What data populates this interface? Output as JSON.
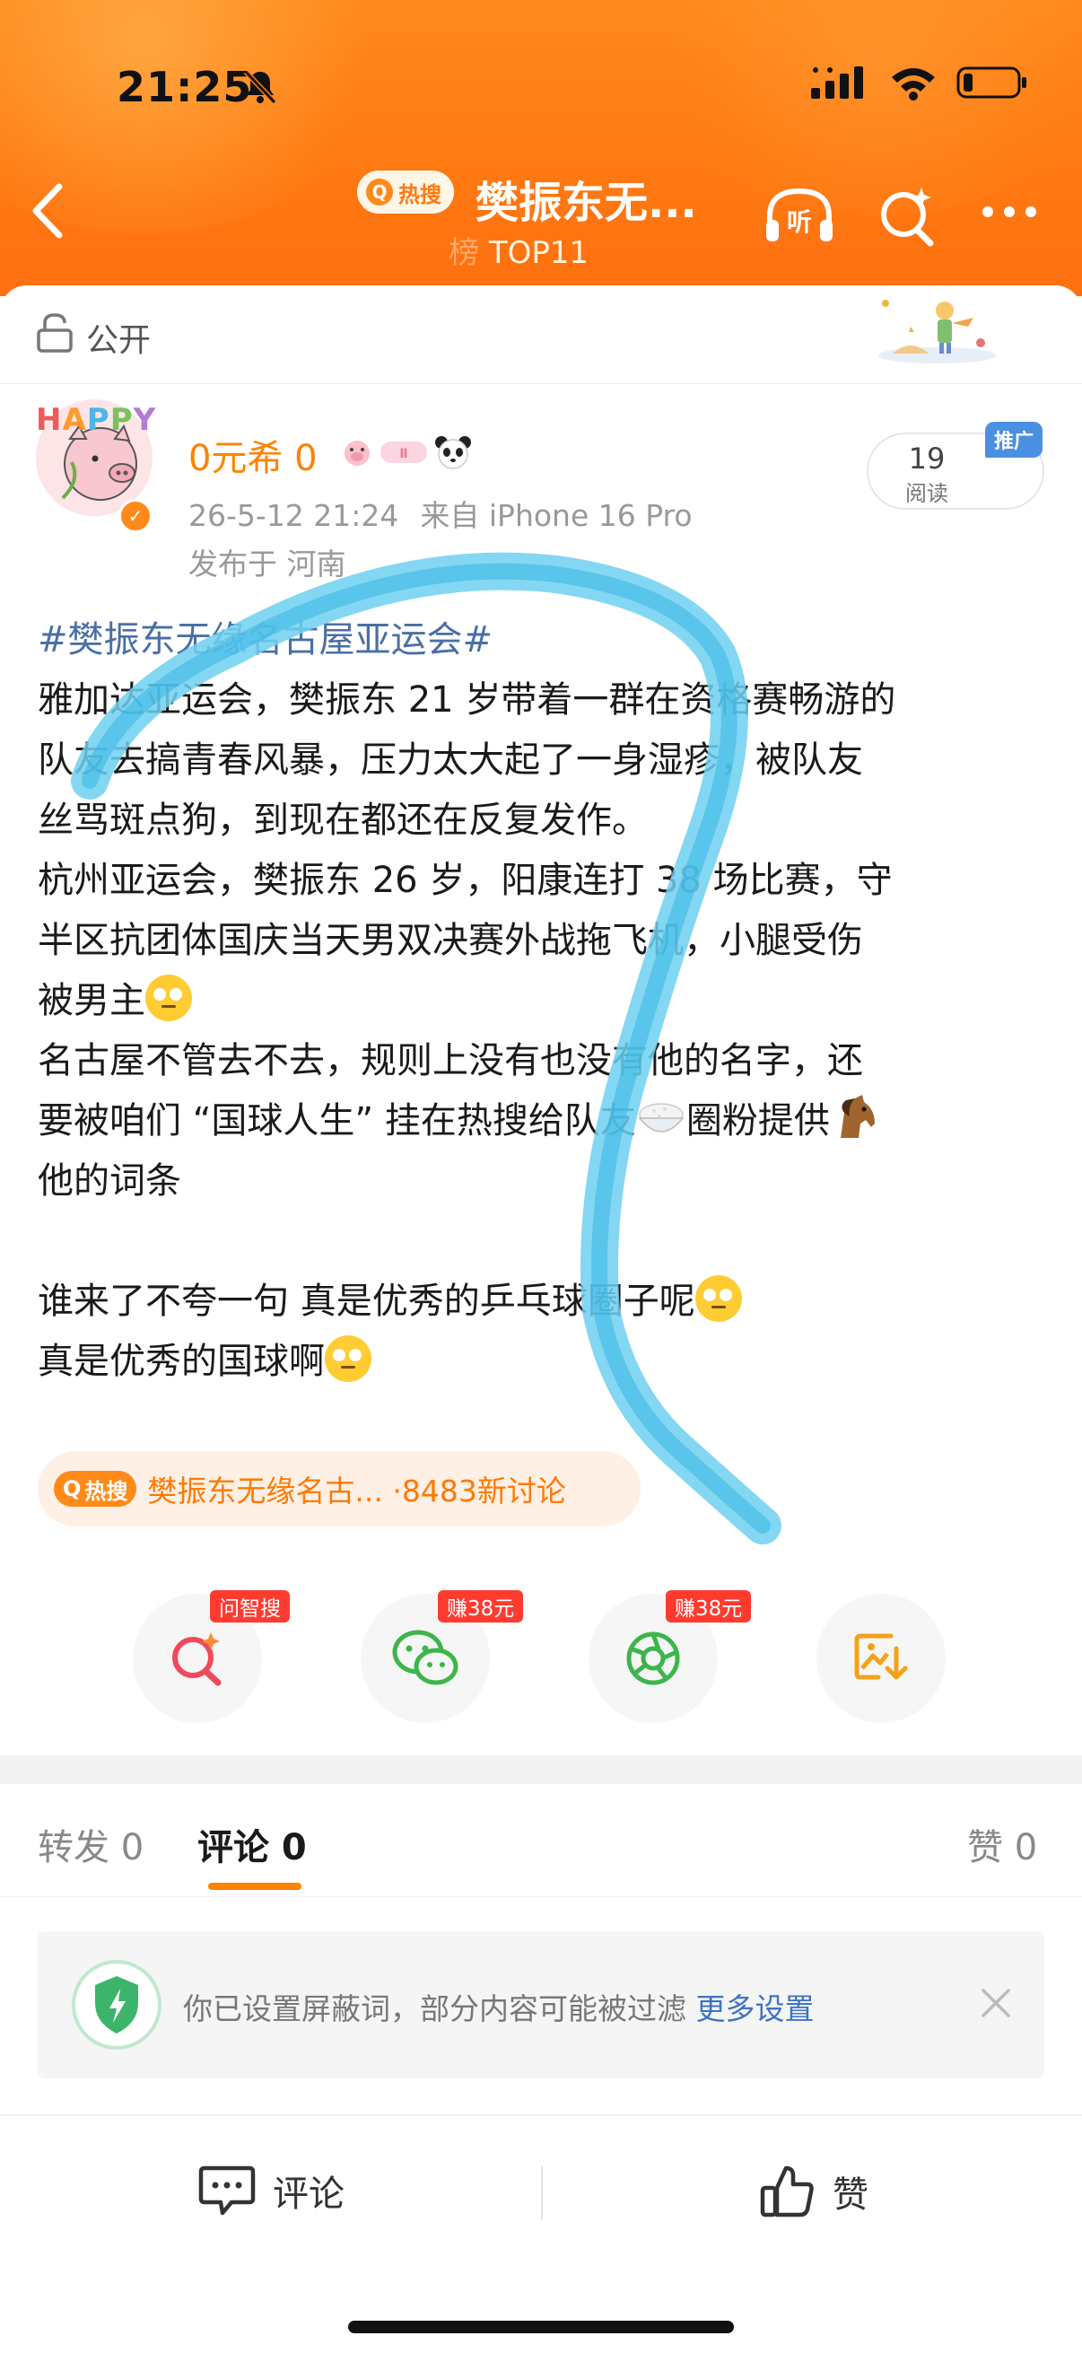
{
  "status_bar": {
    "time": "21:25"
  },
  "nav": {
    "hot_search_tag": "热搜",
    "title": "樊振东无...",
    "rank_blurred": "榜",
    "rank": "TOP11"
  },
  "visibility": {
    "label": "公开"
  },
  "author": {
    "avatar_text": "HAPPY",
    "name": "0元希 0",
    "date": "26-5-12 21:24",
    "source": "来自 iPhone 16 Pro",
    "location": "发布于 河南",
    "read_count": "19",
    "read_label": "阅读",
    "promo_tag": "推广"
  },
  "post": {
    "topic": "#樊振东无缘名古屋亚运会#",
    "lines": [
      "雅加达亚运会，樊振东 21 岁带着一群在资格赛畅游的",
      "队友去搞青春风暴，压力太大起了一身湿疹，被队友",
      "丝骂斑点狗，到现在都还在反复发作。",
      "杭州亚运会，樊振东 26 岁，阳康连打 38 场比赛，守",
      "半区抗团体国庆当天男双决赛外战拖飞机，小腿受伤",
      "被男主",
      "名古屋不管去不去，规则上没有也没有他的名字，还",
      "要被咱们 “国球人生” 挂在热搜给队友",
      "圈粉提供",
      "他的词条",
      "谁来了不夸一句 真是优秀的乒乓球圈子呢",
      "真是优秀的国球啊"
    ]
  },
  "hot_strip": {
    "tag": "热搜",
    "text": "樊振东无缘名古...",
    "discussions": "·8483新讨论"
  },
  "share": {
    "badges": [
      "问智搜",
      "赚38元",
      "赚38元"
    ]
  },
  "tabs": {
    "repost": "转发 0",
    "comment": "评论 0",
    "like": "赞 0"
  },
  "notice": {
    "message": "你已设置屏蔽词，部分内容可能被过滤",
    "link": "更多设置"
  },
  "bottom_bar": {
    "comment": "评论",
    "like": "赞"
  },
  "colors": {
    "header_orange": "#ff7a12",
    "username_orange": "#ff8200",
    "topic_blue": "#4a6fa5",
    "link_blue": "#3d74c5",
    "marker_blue": "#4cc3ec",
    "badge_red": "#ff3b30"
  }
}
